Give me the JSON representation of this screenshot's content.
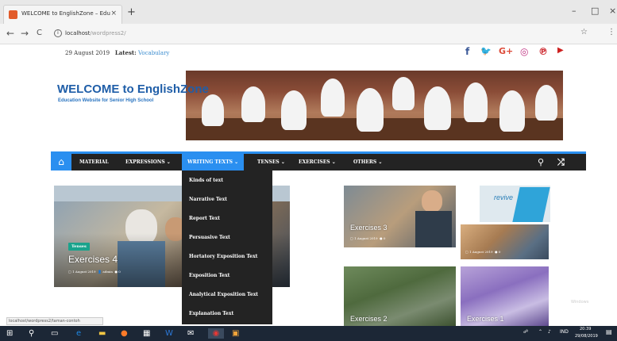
{
  "browser": {
    "tab_title": "WELCOME to EnglishZone – Edu",
    "tab_close": "×",
    "new_tab": "+",
    "win_min": "–",
    "win_max": "□",
    "win_close": "×",
    "back": "←",
    "forward": "→",
    "reload": "C",
    "url_host": "localhost",
    "url_path": "/wordpress2/",
    "star": "☆",
    "menu": "⋮"
  },
  "site": {
    "date": "29 August 2019",
    "latest_label": "Latest:",
    "latest_value": "Vocabulary",
    "title": "WELCOME to EnglishZone",
    "subtitle": "Education Website for Senior High School",
    "social": [
      {
        "name": "facebook-icon",
        "glyph": "f",
        "color": "#3b5998"
      },
      {
        "name": "twitter-icon",
        "glyph": "🐦",
        "color": "#1da1f2"
      },
      {
        "name": "google-plus-icon",
        "glyph": "G+",
        "color": "#dd4b39"
      },
      {
        "name": "instagram-icon",
        "glyph": "◎",
        "color": "#c13584"
      },
      {
        "name": "pinterest-icon",
        "glyph": "℗",
        "color": "#cb2027"
      },
      {
        "name": "youtube-icon",
        "glyph": "▶",
        "color": "#cd201f"
      }
    ],
    "nav": {
      "home_glyph": "⌂",
      "items": [
        "MATERIAL",
        "EXPRESSIONS ⌄",
        "WRITING TEXTS ⌄",
        "TENSES ⌄",
        "EXERCISES ⌄",
        "OTHERS ⌄"
      ],
      "search_glyph": "⚲",
      "random_glyph": "⤮"
    },
    "dropdown": [
      "Kinds of text",
      "Narrative Text",
      "Report Text",
      "Persuasive Text",
      "Hortatory Exposition Text",
      "Exposition Text",
      "Analytical Exposition Text",
      "Explanation Text"
    ],
    "featured": {
      "big": {
        "badge": "Tenses",
        "title": "Exercises 4",
        "date": "1 August 2019",
        "author": "admin",
        "comments": "0"
      },
      "small1": {
        "title": "Exercises 3",
        "date": "1 August 2019",
        "comments": "0"
      },
      "small2": {
        "title": "Exercises 2"
      },
      "small3": {
        "title": "Exercises 1"
      },
      "revive": {
        "logo": "revive",
        "date": "1 August 2019",
        "comments": "0"
      }
    },
    "status_url": "localhost/wordpress2/taman-contoh",
    "watermark": "Windows"
  },
  "taskbar": {
    "lang": "IND",
    "time": "20:39",
    "date": "29/08/2019"
  }
}
